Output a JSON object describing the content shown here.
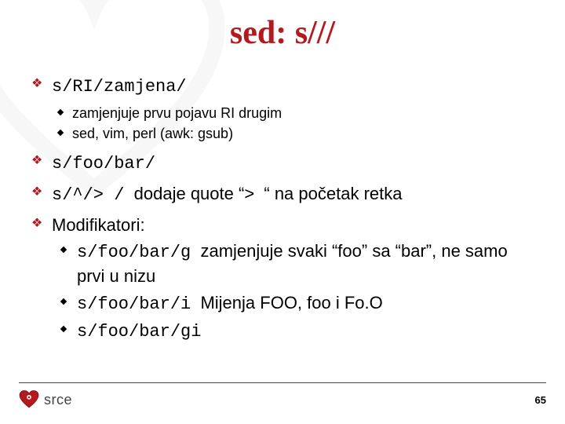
{
  "title": "sed: s///",
  "bullets": [
    {
      "text_html": "<span class='mono'>s/RI/zamjena/</span>",
      "sub": [
        "zamjenjuje prvu pojavu RI drugim",
        "sed, vim, perl (awk: gsub)"
      ]
    },
    {
      "text_html": "<span class='mono'>s/foo/bar/</span>"
    },
    {
      "text_html": "<span class='mono'>s/^/&gt; /</span>&nbsp; dodaje quote “&gt;&nbsp; “ na početak retka"
    },
    {
      "text_html": "Modifikatori:",
      "sub2": [
        "<span class='mono'>s/foo/bar/g</span>&nbsp; zamjenjuje svaki “foo” sa “bar”, ne samo prvi u nizu",
        "<span class='mono'>s/foo/bar/i</span>&nbsp; Mijenja FOO, foo i Fo.O",
        "<span class='mono'>s/foo/bar/gi</span>"
      ]
    }
  ],
  "footer": {
    "brand": "srce",
    "page": "65"
  },
  "colors": {
    "accent": "#b4191e"
  }
}
